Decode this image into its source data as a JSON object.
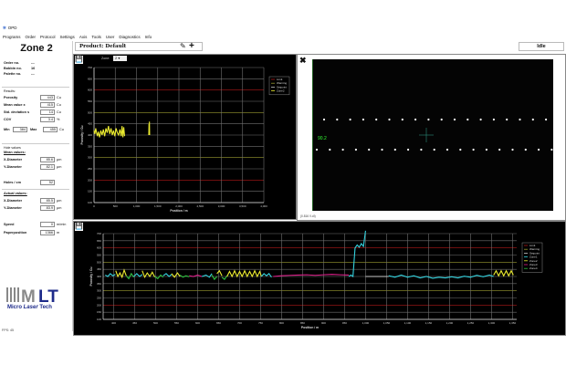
{
  "app": {
    "title": "OPD",
    "menu": [
      "Programs",
      "Order",
      "Protocol",
      "Settings",
      "Axis",
      "Tools",
      "User",
      "Diagnostics",
      "Info"
    ]
  },
  "left": {
    "zone_title": "Zone 2",
    "info": [
      {
        "label": "Order no.",
        "value": "---"
      },
      {
        "label": "Bobbin no.",
        "value": "16"
      },
      {
        "label": "Palette no.",
        "value": "---"
      }
    ],
    "results_header": "Results:",
    "results": [
      {
        "label": "Porosity",
        "value": "443",
        "unit": "Cu"
      },
      {
        "label": "Mean value x",
        "value": "415",
        "unit": "Cu"
      },
      {
        "label": "Std. deviation s",
        "value": "14",
        "unit": "Cu"
      },
      {
        "label": "COV",
        "value": "3.4",
        "unit": "%"
      }
    ],
    "min_label": "Min",
    "min_value": "384",
    "max_label": "Max",
    "max_value": "455",
    "minmax_unit": "Cu",
    "hole_header": "Hole values",
    "mean_header": "Mean values:",
    "mean": [
      {
        "label": "X-Diameter",
        "value": "85.6",
        "unit": "µm"
      },
      {
        "label": "Y-Diameter",
        "value": "82.1",
        "unit": "µm"
      }
    ],
    "holes": {
      "label": "Holes / cm",
      "value": "52"
    },
    "actual_header": "Actual values:",
    "actual": [
      {
        "label": "X-Diameter",
        "value": "85.5",
        "unit": "µm"
      },
      {
        "label": "Y-Diameter",
        "value": "83.9",
        "unit": "µm"
      }
    ],
    "speed": {
      "label": "Speed",
      "value": "0",
      "unit": "m/min"
    },
    "paper": {
      "label": "Paperposition",
      "value": "1366",
      "unit": "m"
    },
    "logo": "MLT Micro Laser Tech",
    "fps": "FPS: 45"
  },
  "toolbar": {
    "product_label": "Product:",
    "product_value": "Default",
    "status": "Idle"
  },
  "colors": {
    "limit": "#b01818",
    "warning": "#9a9a30",
    "setpoint": "#c8c8c8",
    "zone1": "#34d4e0",
    "zone2": "#ecec30",
    "zone3": "#e0208c",
    "zone4": "#30c040",
    "grid": "#707070"
  },
  "camera": {
    "value": "90.2",
    "footer": "(0.816 V-dI)"
  },
  "chart_data": [
    {
      "type": "line",
      "zone_label": "Zone:",
      "zone_value": "2",
      "xlabel": "Position / m",
      "ylabel": "Porosity / Cu",
      "xlim": [
        0,
        4000
      ],
      "ylim": [
        100,
        700
      ],
      "xticks": [
        "0",
        "500",
        "1,000",
        "1,500",
        "2,000",
        "2,500",
        "3,000",
        "3,500",
        "4,000"
      ],
      "yticks": [
        "100",
        "150",
        "200",
        "250",
        "300",
        "350",
        "400",
        "450",
        "500",
        "550",
        "600",
        "650",
        "700"
      ],
      "legend": [
        "Limit",
        "Warning",
        "Setpoint",
        "Zone2"
      ],
      "legend_position": "top-right",
      "grid": true,
      "limits": [
        200,
        600
      ],
      "warnings": [
        300,
        500
      ],
      "series": [
        {
          "name": "Zone2",
          "color_key": "zone2",
          "points": [
            [
              0,
              420
            ],
            [
              20,
              405
            ],
            [
              40,
              430
            ],
            [
              60,
              410
            ],
            [
              80,
              395
            ],
            [
              100,
              415
            ],
            [
              130,
              390
            ],
            [
              160,
              420
            ],
            [
              190,
              400
            ],
            [
              220,
              425
            ],
            [
              250,
              395
            ],
            [
              280,
              430
            ],
            [
              310,
              410
            ],
            [
              340,
              440
            ],
            [
              370,
              405
            ],
            [
              400,
              430
            ],
            [
              430,
              400
            ],
            [
              460,
              420
            ],
            [
              490,
              395
            ],
            [
              520,
              430
            ],
            [
              550,
              410
            ],
            [
              580,
              400
            ],
            [
              610,
              425
            ],
            [
              640,
              395
            ],
            [
              660,
              440
            ],
            [
              680,
              390
            ],
            [
              700,
              435
            ],
            [
              720,
              395
            ]
          ]
        },
        {
          "name": "Zone2",
          "color_key": "zone2",
          "points": [
            [
              1290,
              400
            ],
            [
              1295,
              450
            ],
            [
              1300,
              405
            ],
            [
              1305,
              460
            ],
            [
              1310,
              400
            ]
          ]
        }
      ]
    },
    {
      "type": "line",
      "xlabel": "Position / m",
      "ylabel": "Porosity / Cu",
      "xlim": [
        375,
        1360
      ],
      "ylim": [
        100,
        700
      ],
      "xticks": [
        "400",
        "450",
        "500",
        "550",
        "600",
        "650",
        "700",
        "750",
        "800",
        "850",
        "900",
        "950",
        "1,000",
        "1,050",
        "1,100",
        "1,150",
        "1,200",
        "1,250",
        "1,300",
        "1,350"
      ],
      "yticks": [
        "100",
        "150",
        "200",
        "250",
        "300",
        "350",
        "400",
        "450",
        "500",
        "550",
        "600",
        "650",
        "700"
      ],
      "legend": [
        "Limit",
        "Warning",
        "Setpoint",
        "Zone1",
        "Zone2",
        "Zone3",
        "Zone4"
      ],
      "legend_position": "top-right",
      "grid": true,
      "limits": [
        200,
        600
      ],
      "warnings": [
        300,
        500
      ],
      "series": [
        {
          "name": "Zone1",
          "color_key": "zone1",
          "points": [
            [
              380,
              410
            ],
            [
              386,
              400
            ],
            [
              392,
              420
            ],
            [
              398,
              405
            ],
            [
              404,
              415
            ]
          ]
        },
        {
          "name": "Zone2",
          "color_key": "zone2",
          "points": [
            [
              405,
              440
            ],
            [
              410,
              400
            ],
            [
              415,
              425
            ],
            [
              420,
              395
            ],
            [
              425,
              445
            ],
            [
              430,
              405
            ]
          ]
        },
        {
          "name": "Zone4",
          "color_key": "zone4",
          "points": [
            [
              430,
              405
            ],
            [
              436,
              385
            ],
            [
              442,
              420
            ],
            [
              448,
              395
            ]
          ]
        },
        {
          "name": "Zone1",
          "color_key": "zone1",
          "points": [
            [
              448,
              400
            ],
            [
              455,
              420
            ],
            [
              462,
              400
            ],
            [
              468,
              415
            ]
          ]
        },
        {
          "name": "Zone2",
          "color_key": "zone2",
          "points": [
            [
              468,
              440
            ],
            [
              474,
              395
            ],
            [
              480,
              425
            ],
            [
              486,
              400
            ],
            [
              492,
              430
            ],
            [
              498,
              395
            ]
          ]
        },
        {
          "name": "Zone4",
          "color_key": "zone4",
          "points": [
            [
              498,
              400
            ],
            [
              505,
              385
            ],
            [
              512,
              410
            ],
            [
              518,
              395
            ]
          ]
        },
        {
          "name": "Zone1",
          "color_key": "zone1",
          "points": [
            [
              518,
              405
            ],
            [
              525,
              420
            ],
            [
              532,
              400
            ],
            [
              538,
              415
            ]
          ]
        },
        {
          "name": "Zone2",
          "color_key": "zone2",
          "points": [
            [
              538,
              420
            ],
            [
              545,
              395
            ],
            [
              552,
              425
            ],
            [
              558,
              400
            ]
          ]
        },
        {
          "name": "Zone4",
          "color_key": "zone4",
          "points": [
            [
              558,
              410
            ],
            [
              565,
              395
            ],
            [
              572,
              405
            ],
            [
              580,
              398
            ]
          ]
        },
        {
          "name": "Zone3",
          "color_key": "zone3",
          "points": [
            [
              580,
              405
            ],
            [
              590,
              400
            ],
            [
              600,
              410
            ],
            [
              610,
              400
            ]
          ]
        },
        {
          "name": "Zone1",
          "color_key": "zone1",
          "points": [
            [
              610,
              400
            ],
            [
              620,
              410
            ],
            [
              628,
              395
            ],
            [
              634,
              420
            ]
          ]
        },
        {
          "name": "Zone4",
          "color_key": "zone4",
          "points": [
            [
              634,
              410
            ],
            [
              640,
              380
            ],
            [
              646,
              400
            ]
          ]
        },
        {
          "name": "Zone2",
          "color_key": "zone2",
          "points": [
            [
              646,
              420
            ],
            [
              652,
              440
            ],
            [
              658,
              405
            ]
          ]
        },
        {
          "name": "Zone4",
          "color_key": "zone4",
          "points": [
            [
              658,
              395
            ],
            [
              664,
              380
            ],
            [
              670,
              405
            ]
          ]
        },
        {
          "name": "Zone2",
          "color_key": "zone2",
          "points": [
            [
              670,
              400
            ],
            [
              676,
              435
            ],
            [
              682,
              400
            ],
            [
              688,
              440
            ],
            [
              694,
              400
            ],
            [
              700,
              435
            ],
            [
              706,
              400
            ],
            [
              712,
              440
            ],
            [
              718,
              400
            ],
            [
              724,
              435
            ],
            [
              730,
              400
            ],
            [
              736,
              440
            ],
            [
              742,
              400
            ],
            [
              748,
              435
            ],
            [
              752,
              400
            ]
          ]
        },
        {
          "name": "Zone1",
          "color_key": "zone1",
          "points": [
            [
              752,
              400
            ],
            [
              758,
              420
            ],
            [
              764,
              405
            ],
            [
              770,
              420
            ],
            [
              776,
              395
            ]
          ]
        },
        {
          "name": "Zone3",
          "color_key": "zone3",
          "points": [
            [
              780,
              400
            ],
            [
              800,
              405
            ],
            [
              820,
              408
            ],
            [
              840,
              410
            ],
            [
              860,
              412
            ],
            [
              880,
              408
            ],
            [
              900,
              412
            ],
            [
              920,
              415
            ],
            [
              940,
              412
            ],
            [
              960,
              410
            ]
          ]
        },
        {
          "name": "Zone1",
          "color_key": "zone1",
          "points": [
            [
              960,
              400
            ],
            [
              965,
              410
            ],
            [
              970,
              400
            ],
            [
              975,
              600
            ],
            [
              980,
              620
            ],
            [
              985,
              605
            ],
            [
              990,
              630
            ],
            [
              995,
              610
            ],
            [
              1000,
              760
            ]
          ]
        },
        {
          "name": "Setpoint",
          "color_key": "setpoint",
          "points": [
            [
              1000,
              400
            ],
            [
              1055,
              400
            ]
          ]
        },
        {
          "name": "Zone1",
          "color_key": "zone1",
          "points": [
            [
              1055,
              405
            ],
            [
              1070,
              395
            ],
            [
              1085,
              410
            ],
            [
              1100,
              395
            ],
            [
              1115,
              405
            ],
            [
              1130,
              390
            ],
            [
              1145,
              400
            ],
            [
              1160,
              388
            ],
            [
              1175,
              395
            ],
            [
              1190,
              390
            ],
            [
              1205,
              398
            ],
            [
              1220,
              390
            ],
            [
              1235,
              402
            ],
            [
              1250,
              395
            ],
            [
              1265,
              408
            ],
            [
              1280,
              398
            ],
            [
              1295,
              410
            ],
            [
              1305,
              400
            ]
          ]
        },
        {
          "name": "Zone2",
          "color_key": "zone2",
          "points": [
            [
              1305,
              410
            ],
            [
              1311,
              440
            ],
            [
              1317,
              405
            ],
            [
              1323,
              440
            ],
            [
              1329,
              405
            ],
            [
              1335,
              440
            ],
            [
              1341,
              405
            ],
            [
              1347,
              440
            ],
            [
              1352,
              410
            ]
          ]
        }
      ]
    }
  ]
}
